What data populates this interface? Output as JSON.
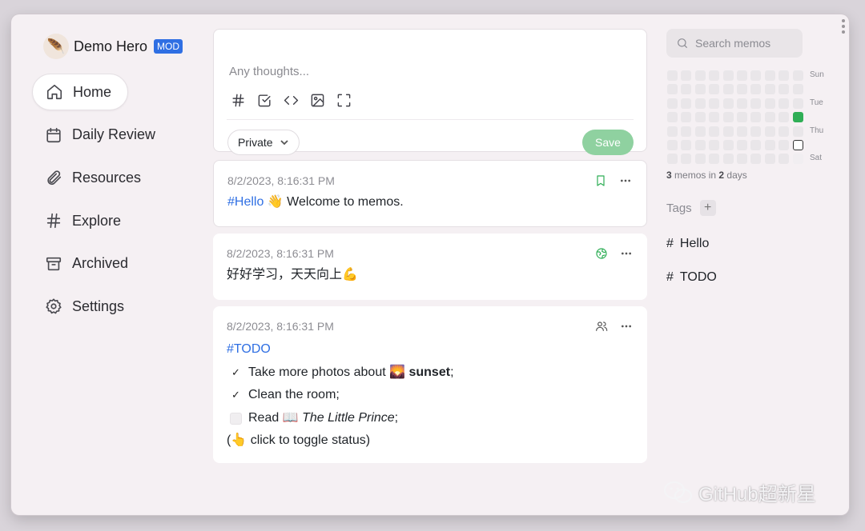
{
  "user": {
    "avatar": "quill-avatar",
    "name": "Demo Hero",
    "badge": "MOD"
  },
  "nav": [
    {
      "label": "Home",
      "icon": "home-icon",
      "active": true
    },
    {
      "label": "Daily Review",
      "icon": "calendar-icon"
    },
    {
      "label": "Resources",
      "icon": "paperclip-icon"
    },
    {
      "label": "Explore",
      "icon": "hash-icon"
    },
    {
      "label": "Archived",
      "icon": "archive-icon"
    },
    {
      "label": "Settings",
      "icon": "gear-icon"
    }
  ],
  "editor": {
    "placeholder": "Any thoughts...",
    "tools": [
      "hash-icon",
      "checkbox-icon",
      "code-icon",
      "image-icon",
      "fullscreen-icon"
    ],
    "visibility": "Private",
    "save_label": "Save"
  },
  "memos": [
    {
      "time": "8/2/2023, 8:16:31 PM",
      "tag": "#Hello",
      "text": " 👋 Welcome to memos.",
      "status_icon": "bookmark-icon"
    },
    {
      "time": "8/2/2023, 8:16:31 PM",
      "text": "好好学习，天天向上💪",
      "status_icon": "globe-icon"
    },
    {
      "time": "8/2/2023, 8:16:31 PM",
      "tag": "#TODO",
      "tasks": [
        {
          "prefix": "Take more photos about 🌄 ",
          "emph": "sunset",
          "suffix": ";",
          "done": true
        },
        {
          "prefix": "Clean the room;",
          "emph": "",
          "suffix": "",
          "done": true
        },
        {
          "prefix": "Read 📖 ",
          "emph": "The Little Prince",
          "suffix": ";",
          "done": false
        }
      ],
      "note": "(👆 click to toggle status)",
      "status_icon": "users-icon"
    }
  ],
  "search": {
    "placeholder": "Search memos"
  },
  "heatmap": {
    "weekday_labels": [
      "Sun",
      "Tue",
      "Thu",
      "Sat"
    ],
    "active_color": "#2fae56"
  },
  "stats": {
    "memo_count": "3",
    "memos_in": "memos in",
    "day_count": "2",
    "days": "days"
  },
  "tags": {
    "title": "Tags",
    "items": [
      {
        "label": "Hello"
      },
      {
        "label": "TODO"
      }
    ]
  },
  "watermark": {
    "text": "GitHub超新星"
  },
  "colors": {
    "accent": "#2f6fe3",
    "save": "#8fd1a0",
    "heat": "#2fae56"
  }
}
